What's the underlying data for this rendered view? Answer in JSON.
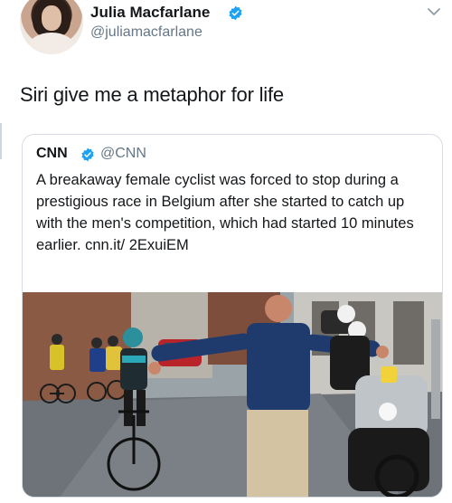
{
  "user": {
    "name": "Julia Macfarlane",
    "handle": "@juliamacfarlane"
  },
  "tweet": {
    "text": "Siri give me a metaphor for life"
  },
  "quoted_tweet": {
    "name": "CNN",
    "handle": "@CNN",
    "text": "A breakaway female cyclist was forced to stop during a prestigious race in Belgium after she started to catch up with the men's competition, which had started 10 minutes earlier. cnn.it/ 2ExuiEM"
  },
  "colors": {
    "verified": "#1da1f2",
    "secondary_text": "#657786",
    "primary_text": "#14171a"
  }
}
